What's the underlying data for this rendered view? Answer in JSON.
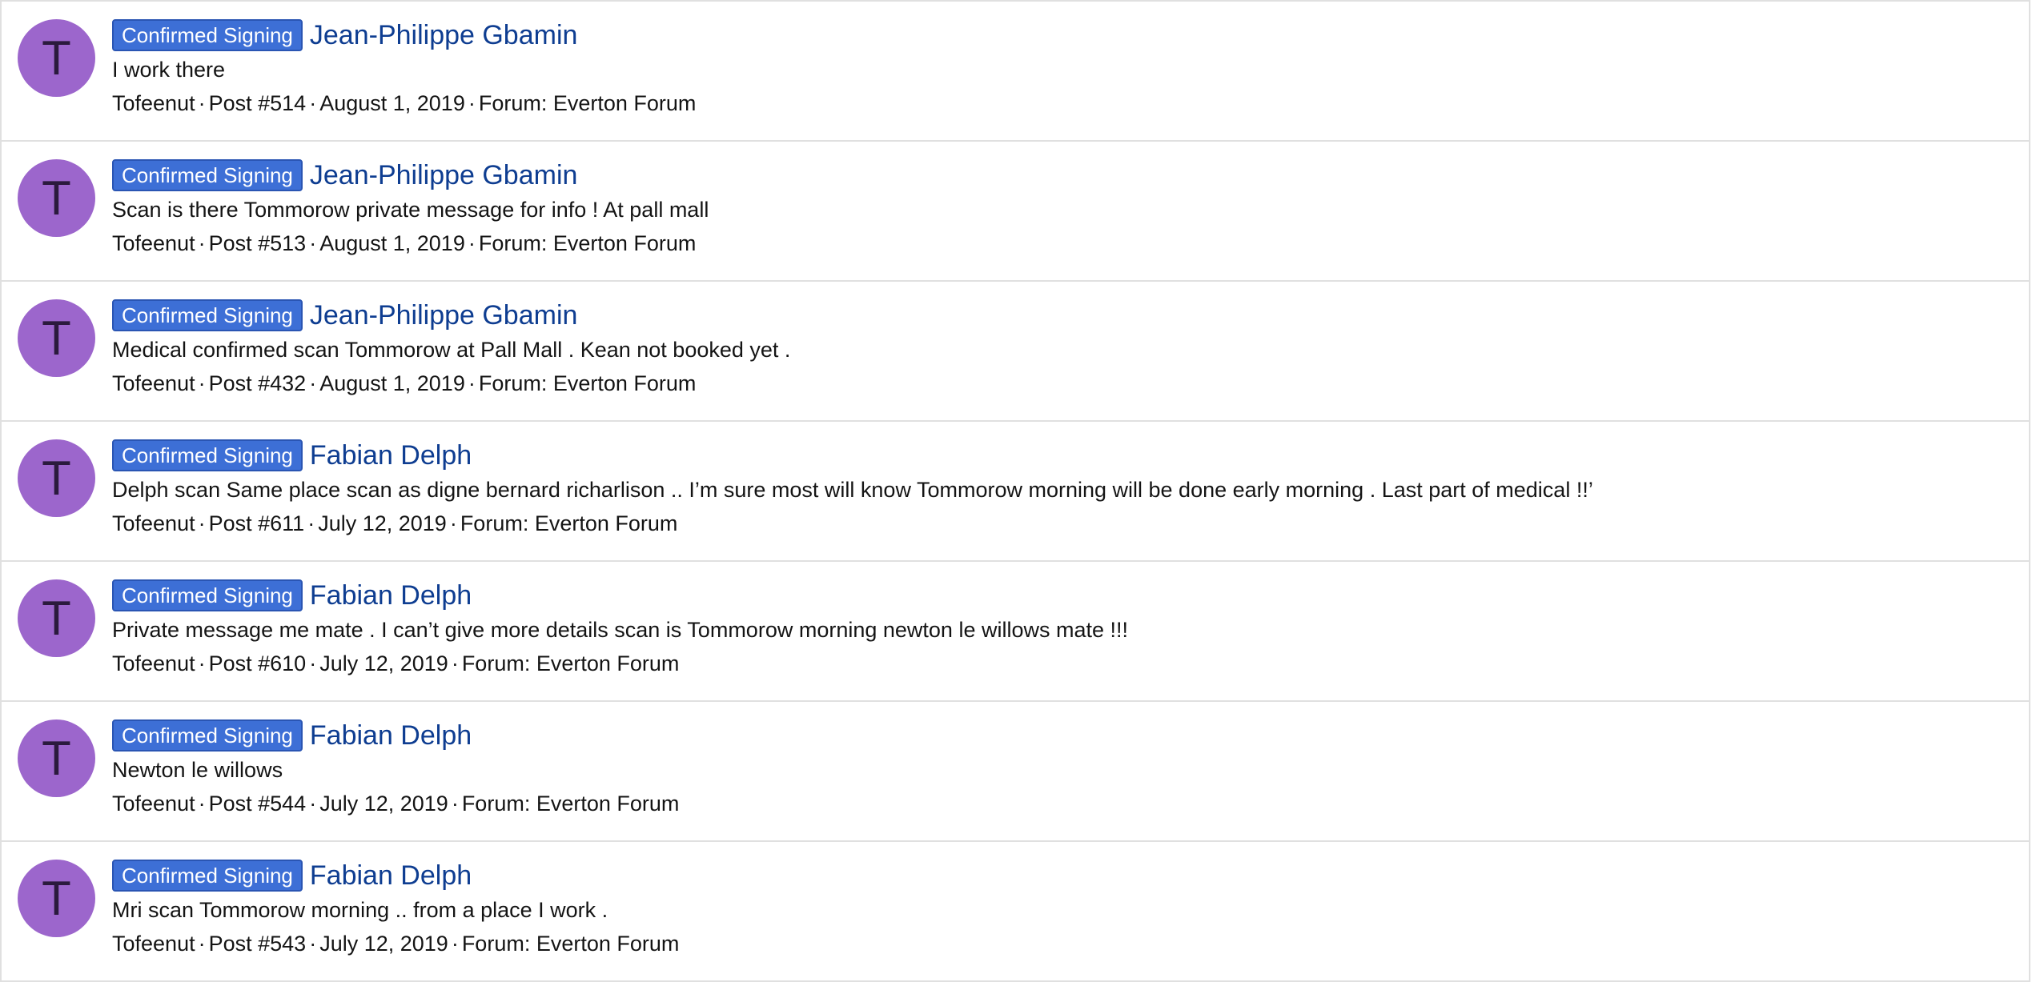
{
  "results": [
    {
      "avatar_letter": "T",
      "badge": "Confirmed Signing",
      "thread": "Jean-Philippe Gbamin",
      "snippet": "I work there",
      "author": "Tofeenut",
      "post": "Post #514",
      "date": "August 1, 2019",
      "forum": "Forum: Everton Forum"
    },
    {
      "avatar_letter": "T",
      "badge": "Confirmed Signing",
      "thread": "Jean-Philippe Gbamin",
      "snippet": "Scan is there Tommorow private message for info ! At pall mall",
      "author": "Tofeenut",
      "post": "Post #513",
      "date": "August 1, 2019",
      "forum": "Forum: Everton Forum"
    },
    {
      "avatar_letter": "T",
      "badge": "Confirmed Signing",
      "thread": "Jean-Philippe Gbamin",
      "snippet": "Medical confirmed scan Tommorow at Pall Mall . Kean not booked yet .",
      "author": "Tofeenut",
      "post": "Post #432",
      "date": "August 1, 2019",
      "forum": "Forum: Everton Forum"
    },
    {
      "avatar_letter": "T",
      "badge": "Confirmed Signing",
      "thread": "Fabian Delph",
      "snippet": "Delph scan Same place scan as digne bernard richarlison .. I’m sure most will know Tommorow morning will be done early morning . Last part of medical !!’",
      "author": "Tofeenut",
      "post": "Post #611",
      "date": "July 12, 2019",
      "forum": "Forum: Everton Forum"
    },
    {
      "avatar_letter": "T",
      "badge": "Confirmed Signing",
      "thread": "Fabian Delph",
      "snippet": "Private message me mate . I can’t give more details scan is Tommorow morning newton le willows mate !!!",
      "author": "Tofeenut",
      "post": "Post #610",
      "date": "July 12, 2019",
      "forum": "Forum: Everton Forum"
    },
    {
      "avatar_letter": "T",
      "badge": "Confirmed Signing",
      "thread": "Fabian Delph",
      "snippet": "Newton le willows",
      "author": "Tofeenut",
      "post": "Post #544",
      "date": "July 12, 2019",
      "forum": "Forum: Everton Forum"
    },
    {
      "avatar_letter": "T",
      "badge": "Confirmed Signing",
      "thread": "Fabian Delph",
      "snippet": "Mri scan Tommorow morning .. from a place I work .",
      "author": "Tofeenut",
      "post": "Post #543",
      "date": "July 12, 2019",
      "forum": "Forum: Everton Forum"
    }
  ],
  "meta_separator": "·",
  "colors": {
    "avatar_bg": "#9c66cc",
    "badge_bg": "#3d6fd6",
    "link": "#0e3d91",
    "border": "#e0e0e0"
  }
}
